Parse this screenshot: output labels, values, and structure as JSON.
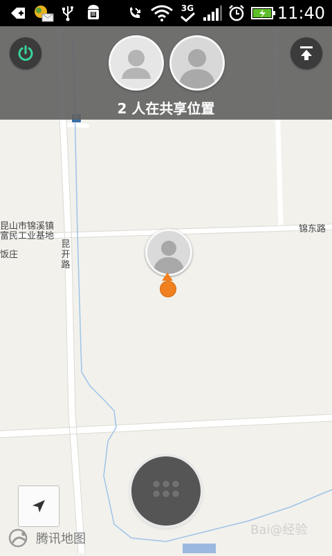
{
  "status_bar": {
    "time": "11:40",
    "network": "3G",
    "icons": [
      "add-icon",
      "sync-app-icon",
      "usb-icon",
      "android-debug-icon",
      "missed-call-icon",
      "wifi-icon",
      "3g-icon",
      "signal-icon",
      "alarm-icon",
      "battery-charging-icon"
    ]
  },
  "share_banner": {
    "text": "2 人在共享位置",
    "people_count": 2
  },
  "map": {
    "labels": {
      "town_line1": "昆山市锦溪镇",
      "town_line2": "富民工业基地",
      "place": "饭庄",
      "road_vertical": "昆开路",
      "road_east": "锦东路"
    }
  },
  "controls": {
    "power": "power-icon",
    "top": "upload-to-top-icon",
    "menu": "grid-dots-icon",
    "locate": "navigation-arrow-icon"
  },
  "brand": {
    "name": "腾讯地图"
  },
  "watermark": {
    "text": "Bai@经验"
  },
  "colors": {
    "accent_green": "#39d39a",
    "pin_orange": "#f08020",
    "overlay_gray": "#606060",
    "map_background": "#f2f1ec"
  }
}
